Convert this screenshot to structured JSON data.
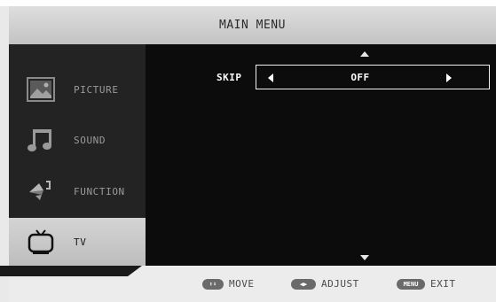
{
  "header": {
    "title": "MAIN MENU"
  },
  "sidebar": {
    "items": [
      {
        "label": "PICTURE",
        "icon": "picture-icon"
      },
      {
        "label": "SOUND",
        "icon": "music-note-icon"
      },
      {
        "label": "FUNCTION",
        "icon": "function-icon"
      },
      {
        "label": "TV",
        "icon": "tv-icon",
        "selected": true
      }
    ]
  },
  "main": {
    "setting_label": "SKIP",
    "setting_value": "OFF"
  },
  "footer": {
    "move": {
      "key": "⬆⬇",
      "label": "MOVE"
    },
    "adjust": {
      "key": "◀▶",
      "label": "ADJUST"
    },
    "exit": {
      "key": "MENU",
      "label": "EXIT"
    }
  },
  "colors": {
    "selected_bg": "#c9c9c9",
    "panel_bg": "#0c0c0c",
    "sidebar_bg": "#232323"
  }
}
